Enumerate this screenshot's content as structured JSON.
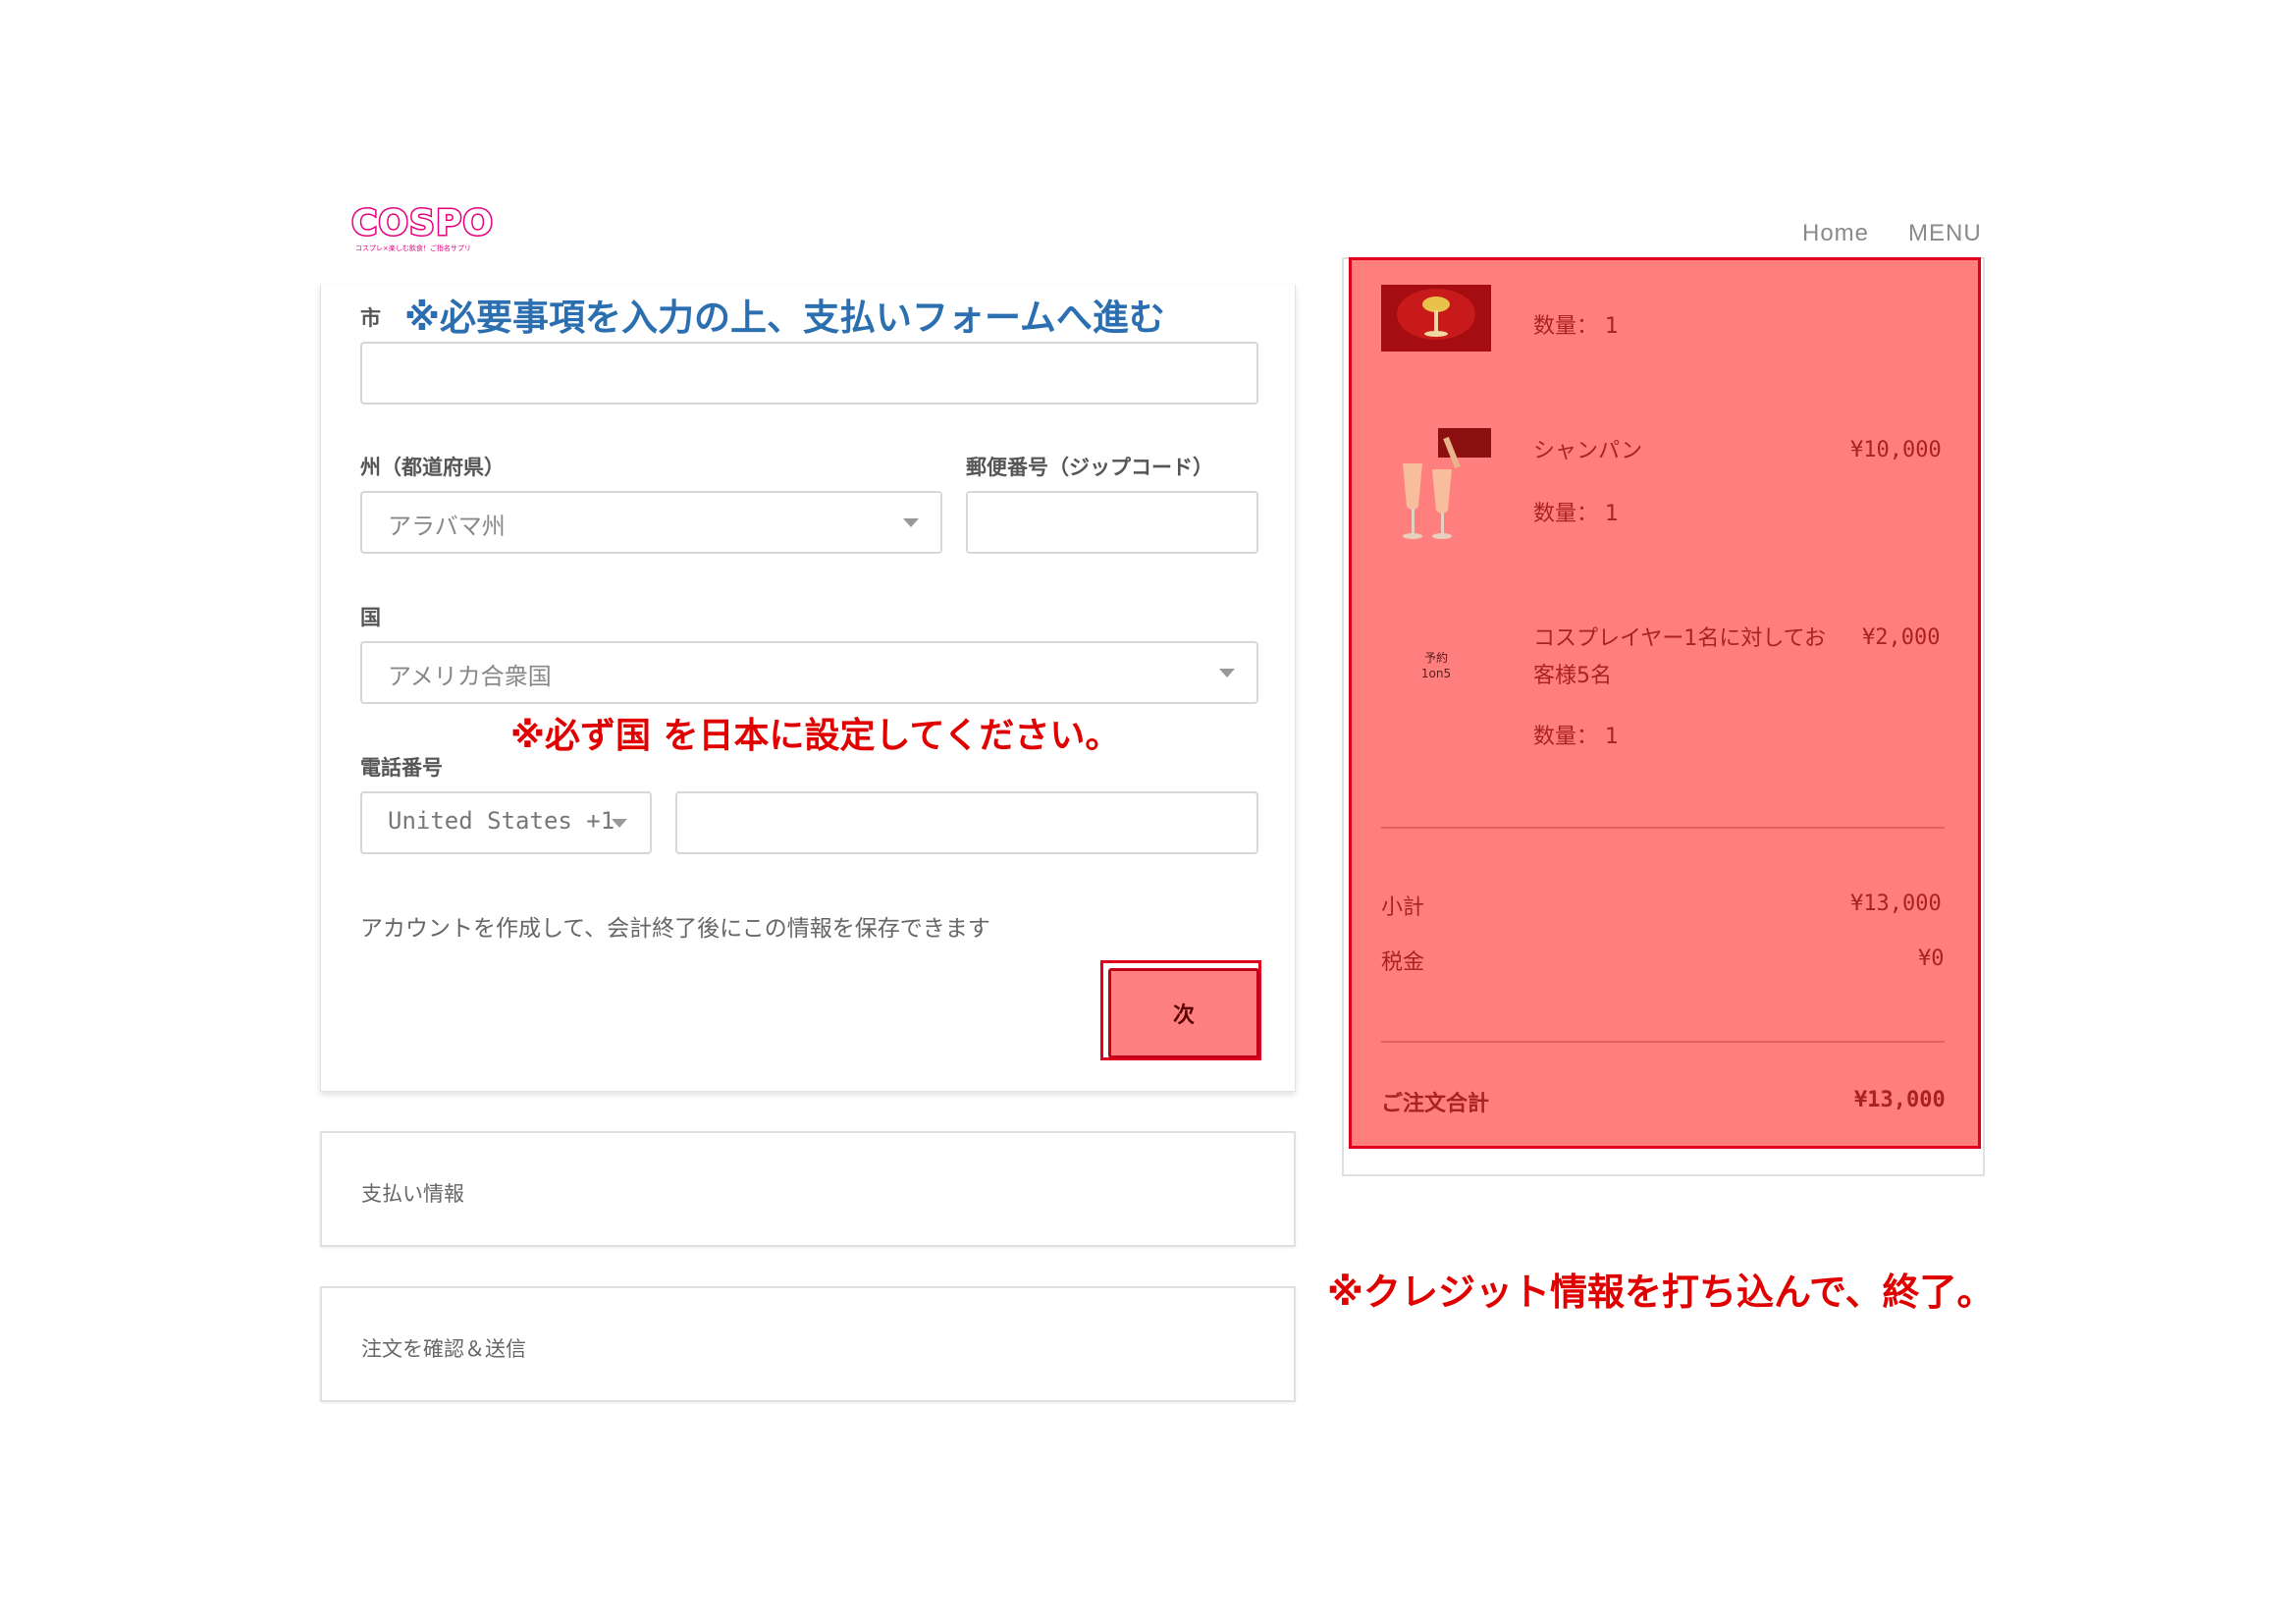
{
  "header": {
    "logo_text": "COSPO",
    "logo_sub": "コスプレ×楽しむ飲食！ご指名サプリ",
    "nav": [
      "Home",
      "MENU"
    ]
  },
  "form": {
    "city_label": "市",
    "city_value": "",
    "state_label": "州（都道府県）",
    "state_value": "アラバマ州",
    "zip_label": "郵便番号（ジップコード）",
    "zip_value": "",
    "country_label": "国",
    "country_value": "アメリカ合衆国",
    "phone_label": "電話番号",
    "phone_country": "United States +1",
    "phone_value": "",
    "account_info": "アカウントを作成して、会計終了後にこの情報を保存できます",
    "next_label": "次"
  },
  "sections": {
    "payment": "支払い情報",
    "review": "注文を確認＆送信"
  },
  "annotations": {
    "blue_note": "※必要事項を入力の上、支払いフォームへ進む",
    "country_note": "※必ず国 を日本に設定してください。",
    "credit_note": "※クレジット情報を打ち込んで、終了。"
  },
  "summary": {
    "items": [
      {
        "name": "",
        "price": "",
        "qty": "数量： 1"
      },
      {
        "name": "シャンパン",
        "price": "¥10,000",
        "qty": "数量： 1"
      },
      {
        "name_line1": "コスプレイヤー1名に対してお",
        "name_line2": "客様5名",
        "price": "¥2,000",
        "qty": "数量： 1",
        "thumb_line1": "予約",
        "thumb_line2": "1on5"
      }
    ],
    "subtotal_label": "小計",
    "subtotal_value": "¥13,000",
    "tax_label": "税金",
    "tax_value": "¥0",
    "total_label": "ご注文合計",
    "total_value": "¥13,000"
  },
  "colors": {
    "accent_pink": "#e4007f",
    "annotation_red": "#e00000",
    "annotation_blue": "#2b6fb0",
    "overlay": "#ff7f7f"
  }
}
